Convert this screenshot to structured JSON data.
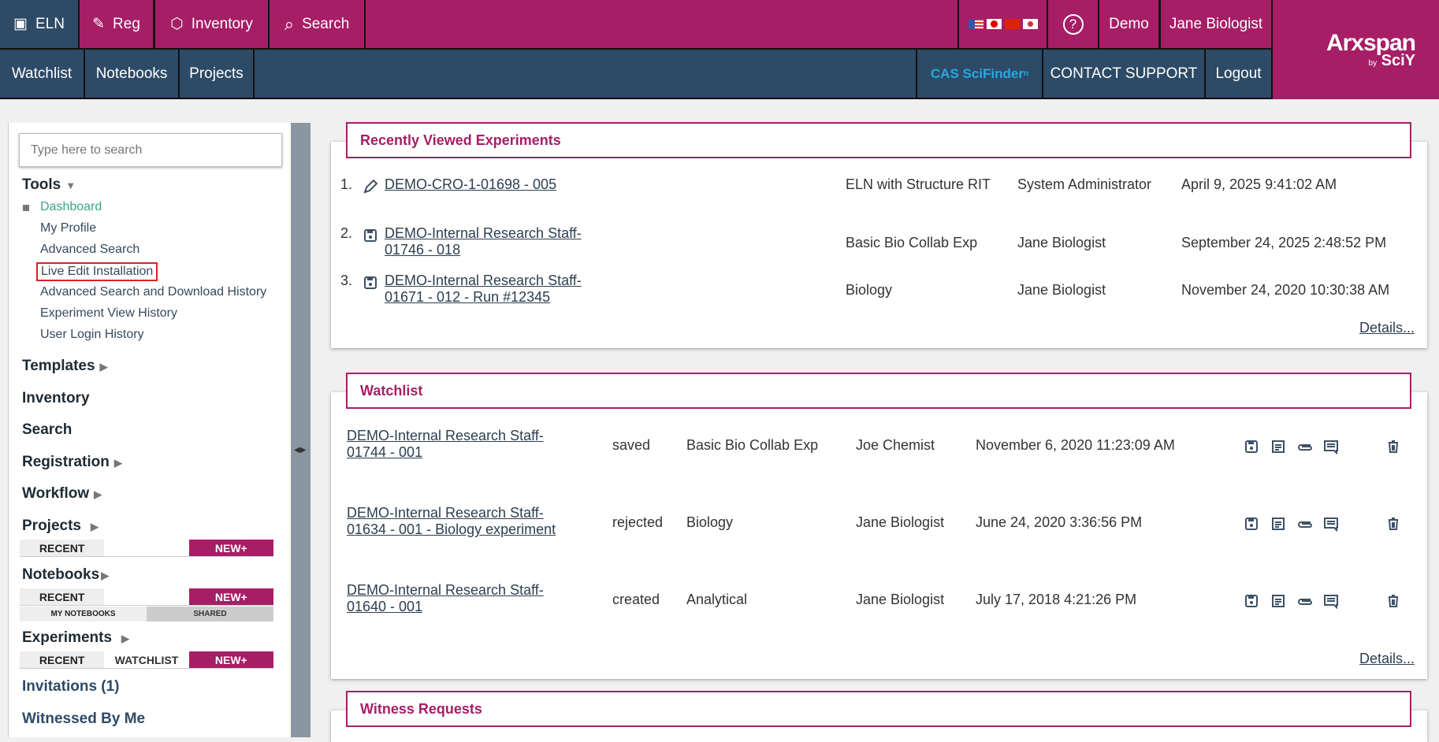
{
  "topnav": {
    "eln": "ELN",
    "reg": "Reg",
    "inventory": "Inventory",
    "search": "Search",
    "demo": "Demo",
    "user": "Jane Biologist",
    "watchlist": "Watchlist",
    "notebooks": "Notebooks",
    "projects": "Projects",
    "cas": "CAS SciFinder",
    "cas_sup": "n",
    "contact": "CONTACT SUPPORT",
    "logout": "Logout",
    "logo_main": "Arxspan",
    "logo_by": "by",
    "logo_sub": "SciY"
  },
  "sidebar": {
    "search_placeholder": "Type here to search",
    "tools": "Tools",
    "tool_items": [
      "Dashboard",
      "My Profile",
      "Advanced Search",
      "Live Edit Installation",
      "Advanced Search and Download History",
      "Experiment View History",
      "User Login History"
    ],
    "templates": "Templates",
    "inventory": "Inventory",
    "search": "Search",
    "registration": "Registration",
    "workflow": "Workflow",
    "projects": "Projects",
    "notebooks": "Notebooks",
    "experiments": "Experiments",
    "recent": "RECENT",
    "watchlist": "WATCHLIST",
    "new": "NEW+",
    "my_notebooks": "MY NOTEBOOKS",
    "shared": "SHARED",
    "invitations": "Invitations (1)",
    "witnessed": "Witnessed By Me"
  },
  "recent": {
    "title": "Recently Viewed Experiments",
    "details": "Details...",
    "rows": [
      {
        "n": "1.",
        "name1": "DEMO-CRO-1-01698 - 005",
        "name2": "",
        "type": "ELN with Structure RIT",
        "user": "System Administrator",
        "date": "April 9, 2025 9:41:02 AM",
        "icon": "pencil-icon"
      },
      {
        "n": "2.",
        "name1": "DEMO-Internal Research Staff-",
        "name2": "01746 - 018",
        "type": "Basic Bio Collab Exp",
        "user": "Jane Biologist",
        "date": "September 24, 2025 2:48:52 PM",
        "icon": "save-icon"
      },
      {
        "n": "3.",
        "name1": "DEMO-Internal Research Staff-",
        "name2": "01671 - 012 - Run #12345",
        "type": "Biology",
        "user": "Jane Biologist",
        "date": "November 24, 2020 10:30:38 AM",
        "icon": "save-icon"
      }
    ]
  },
  "watchlist": {
    "title": "Watchlist",
    "details": "Details...",
    "rows": [
      {
        "name1": "DEMO-Internal Research Staff-",
        "name2": "01744 - 001",
        "status": "saved",
        "type": "Basic Bio Collab Exp",
        "user": "Joe Chemist",
        "date": "November 6, 2020 11:23:09 AM"
      },
      {
        "name1": "DEMO-Internal Research Staff-",
        "name2": "01634 - 001 - Biology experiment",
        "status": "rejected",
        "type": "Biology",
        "user": "Jane Biologist",
        "date": "June 24, 2020 3:36:56 PM"
      },
      {
        "name1": "DEMO-Internal Research Staff-",
        "name2": "01640 - 001",
        "status": "created",
        "type": "Analytical",
        "user": "Jane Biologist",
        "date": "July 17, 2018 4:21:26 PM"
      }
    ]
  },
  "witness": {
    "title": "Witness Requests"
  }
}
